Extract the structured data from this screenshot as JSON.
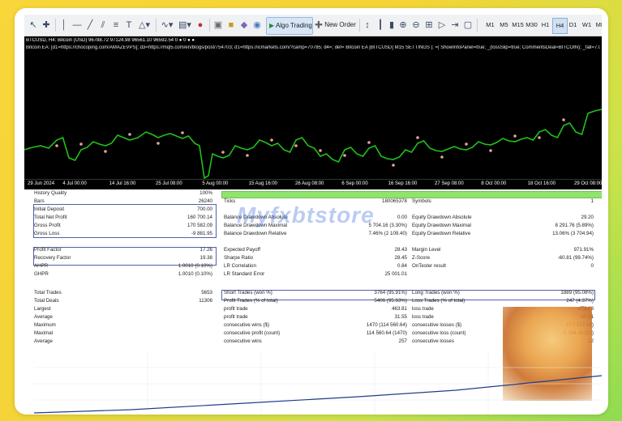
{
  "toolbar": {
    "algo_trading": "Algo Trading",
    "new_order": "New Order",
    "timeframes": [
      "M1",
      "M5",
      "M15",
      "M30",
      "H1",
      "H4",
      "D1",
      "W1",
      "MN"
    ],
    "active_timeframe": "H4"
  },
  "chart": {
    "header_line1": "BTCUSD, H4: Bitcoin (USD) 96788.72 97124.98 96561.10 96592.54 0 ● 0 ● ●",
    "header_line2": "Bitcoin EA: [d1=https://chocoping.com/AMAZEVPS]; d3=https://mql5.com/en/blogs/post/754703; d1=https://icmarkets.com/?camp=70785; d4=; def= Bitcoin EA [BITCUSD] M15 SETTINGS |: =| ShowInfoPanel=true; _(lossSlip=true; CommentsDeal=BITCOIN); _fall=7.0; MinimalLOT=0.1; MLF=99...",
    "time_labels": [
      "29 Jun 2024",
      "4 Jul 00:00",
      "14 Jul 16:00",
      "25 Jul 08:00",
      "5 Aug 00:00",
      "15 Aug 16:00",
      "26 Aug 08:00",
      "6 Sep 00:00",
      "16 Sep 16:00",
      "27 Sep 08:00",
      "8 Oct 00:00",
      "18 Oct 16:00",
      "29 Oct 08:00"
    ],
    "colors": {
      "background": "#000000",
      "price_line": "#21c11b",
      "markers": "#e6a29a"
    }
  },
  "watermark": "Myfxbtstore",
  "report": {
    "rows": [
      {
        "l": "History Quality",
        "v": "100%"
      },
      {
        "l": "Bars",
        "v": "26240",
        "m": "Ticks",
        "mv": "180065378",
        "r": "Symbols",
        "rv": "1"
      },
      {
        "l": "Initial Deposit",
        "v": "700.00"
      },
      {
        "l": "Total Net Profit",
        "v": "160 700.14",
        "m": "Balance Drawdown Absolute",
        "mv": "0.00",
        "r": "Equity Drawdown Absolute",
        "rv": "29.20"
      },
      {
        "l": "Gross Profit",
        "v": "170 582.09",
        "m": "Balance Drawdown Maximal",
        "mv": "5 704.16 (3.30%)",
        "r": "Equity Drawdown Maximal",
        "rv": "8 291.76 (5.89%)"
      },
      {
        "l": "Gross Loss",
        "v": "-9 881.95",
        "m": "Balance Drawdown Relative",
        "mv": "7.46% (2 109.40)",
        "r": "Equity Drawdown Relative",
        "rv": "13.06% (3 704.94)"
      },
      {
        "l": "Profit Factor",
        "v": "17.26",
        "m": "Expected Payoff",
        "mv": "28.43",
        "r": "Margin Level",
        "rv": "971.91%"
      },
      {
        "l": "Recovery Factor",
        "v": "19.38",
        "m": "Sharpe Ratio",
        "mv": "28.45",
        "r": "Z-Score",
        "rv": "-60.81 (99.74%)"
      },
      {
        "l": "AHPR",
        "v": "1.0010 (0.10%)",
        "m": "LR Correlation",
        "mv": "0.84",
        "r": "OnTester result",
        "rv": "0"
      },
      {
        "l": "GHPR",
        "v": "1.0010 (0.10%)",
        "m": "LR Standard Error",
        "mv": "25 001.01"
      },
      {
        "l": "Total Trades",
        "v": "5653",
        "m": "Short Trades (won %)",
        "mv": "3764 (95.91%)",
        "r": "Long Trades (won %)",
        "rv": "1889 (95.08%)"
      },
      {
        "l": "Total Deals",
        "v": "11306",
        "m": "Profit Trades (% of total)",
        "mv": "5406 (95.63%)",
        "r": "Loss Trades (% of total)",
        "rv": "247 (4.37%)"
      },
      {
        "l": "Largest",
        "v": "",
        "m": "profit trade",
        "mv": "463.81",
        "r": "loss trade",
        "rv": "-473.68"
      },
      {
        "l": "Average",
        "v": "",
        "m": "profit trade",
        "mv": "31.55",
        "r": "loss trade",
        "rv": "-40.01"
      },
      {
        "l": "Maximum",
        "v": "",
        "m": "consecutive wins ($)",
        "mv": "1470 (114 560.64)",
        "r": "consecutive losses ($)",
        "rv": "17 (-157.16)"
      },
      {
        "l": "Maximal",
        "v": "",
        "m": "consecutive profit (count)",
        "mv": "114 560.64 (1470)",
        "r": "consecutive loss (count)",
        "rv": "-1 294.16 (12)"
      },
      {
        "l": "Average",
        "v": "",
        "m": "consecutive wins",
        "mv": "257",
        "r": "consecutive losses",
        "rv": "12"
      }
    ]
  }
}
